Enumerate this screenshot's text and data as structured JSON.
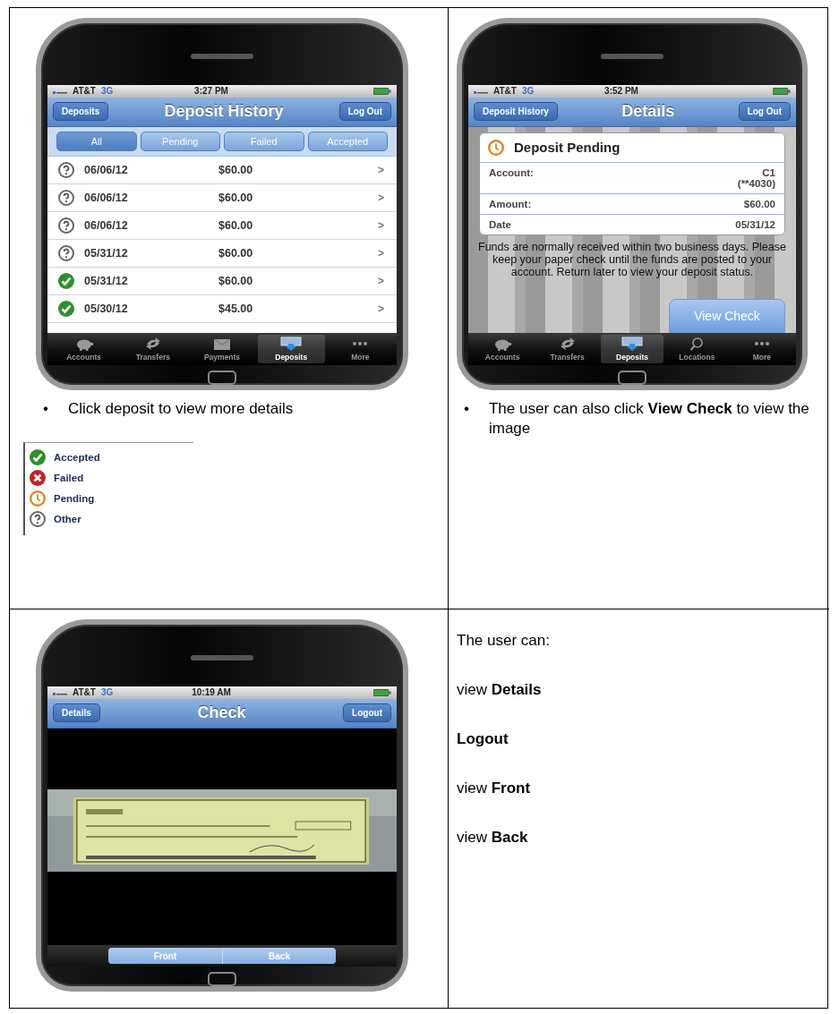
{
  "panels": [
    {
      "kind": "history",
      "phone": {
        "status": {
          "carrier": "AT&T",
          "network": "3G",
          "time": "3:27 PM"
        },
        "nav": {
          "back": "Deposits",
          "title": "Deposit History",
          "action": "Log Out"
        },
        "filters": [
          {
            "label": "All",
            "selected": true
          },
          {
            "label": "Pending",
            "selected": false
          },
          {
            "label": "Failed",
            "selected": false
          },
          {
            "label": "Accepted",
            "selected": false
          }
        ],
        "rows": [
          {
            "kind": "other",
            "date": "06/06/12",
            "amount": "$60.00",
            "chevron": ">"
          },
          {
            "kind": "other",
            "date": "06/06/12",
            "amount": "$60.00",
            "chevron": ">"
          },
          {
            "kind": "other",
            "date": "06/06/12",
            "amount": "$60.00",
            "chevron": ">"
          },
          {
            "kind": "other",
            "date": "05/31/12",
            "amount": "$60.00",
            "chevron": ">"
          },
          {
            "kind": "accepted",
            "date": "05/31/12",
            "amount": "$60.00",
            "chevron": ">"
          },
          {
            "kind": "accepted",
            "date": "05/30/12",
            "amount": "$45.00",
            "chevron": ">"
          }
        ],
        "tabs": [
          {
            "label": "Accounts",
            "kind": "accounts",
            "selected": false
          },
          {
            "label": "Transfers",
            "kind": "transfers",
            "selected": false
          },
          {
            "label": "Payments",
            "kind": "payments",
            "selected": false
          },
          {
            "label": "Deposits",
            "kind": "deposits",
            "selected": true
          },
          {
            "label": "More",
            "kind": "more",
            "selected": false
          }
        ]
      },
      "captions": [
        {
          "bullet": "•",
          "text": "Click deposit to view more details",
          "bold": false
        }
      ],
      "legend": [
        {
          "kind": "accepted",
          "label": "Accepted"
        },
        {
          "kind": "failed",
          "label": "Failed"
        },
        {
          "kind": "pending",
          "label": "Pending"
        },
        {
          "kind": "other",
          "label": "Other"
        }
      ]
    },
    {
      "kind": "details",
      "phone": {
        "status": {
          "carrier": "AT&T",
          "network": "3G",
          "time": "3:52 PM"
        },
        "nav": {
          "back": "Deposit History",
          "title": "Details",
          "action": "Log Out"
        },
        "card": {
          "kind": "pending",
          "title": "Deposit Pending",
          "fields": [
            {
              "label": "Account:",
              "value": "C1\n(**4030)"
            },
            {
              "label": "Amount:",
              "value": "$60.00"
            },
            {
              "label": "Date",
              "value": "05/31/12"
            }
          ]
        },
        "note": "Funds are normally received within two business days. Please keep your paper check until the funds are posted to your account. Return later to view your deposit status.",
        "button": "View Check",
        "tabs": [
          {
            "label": "Accounts",
            "kind": "accounts",
            "selected": false
          },
          {
            "label": "Transfers",
            "kind": "transfers",
            "selected": false
          },
          {
            "label": "Deposits",
            "kind": "deposits",
            "selected": true
          },
          {
            "label": "Locations",
            "kind": "locations",
            "selected": false
          },
          {
            "label": "More",
            "kind": "more",
            "selected": false
          }
        ]
      },
      "captions": [
        {
          "bullet": "•",
          "text": "The user can also click **View Check** to view the image",
          "bold": false
        }
      ]
    },
    {
      "kind": "check",
      "phone": {
        "status": {
          "carrier": "AT&T",
          "network": "3G",
          "time": "10:19 AM"
        },
        "nav": {
          "back": "Details",
          "title": "Check",
          "action": "Logout"
        },
        "image": {
          "kind": "picture"
        },
        "segments": [
          "Front",
          "Back"
        ]
      }
    },
    {
      "kind": "text",
      "captions": [
        {
          "text": "The user can:",
          "bold": false
        },
        {
          "text": "view **Details**",
          "bold": false
        },
        {
          "text": "Logout",
          "bold": true
        },
        {
          "text": "view **Front**",
          "bold": false
        },
        {
          "text": "view **Back**",
          "bold": false
        }
      ]
    }
  ]
}
